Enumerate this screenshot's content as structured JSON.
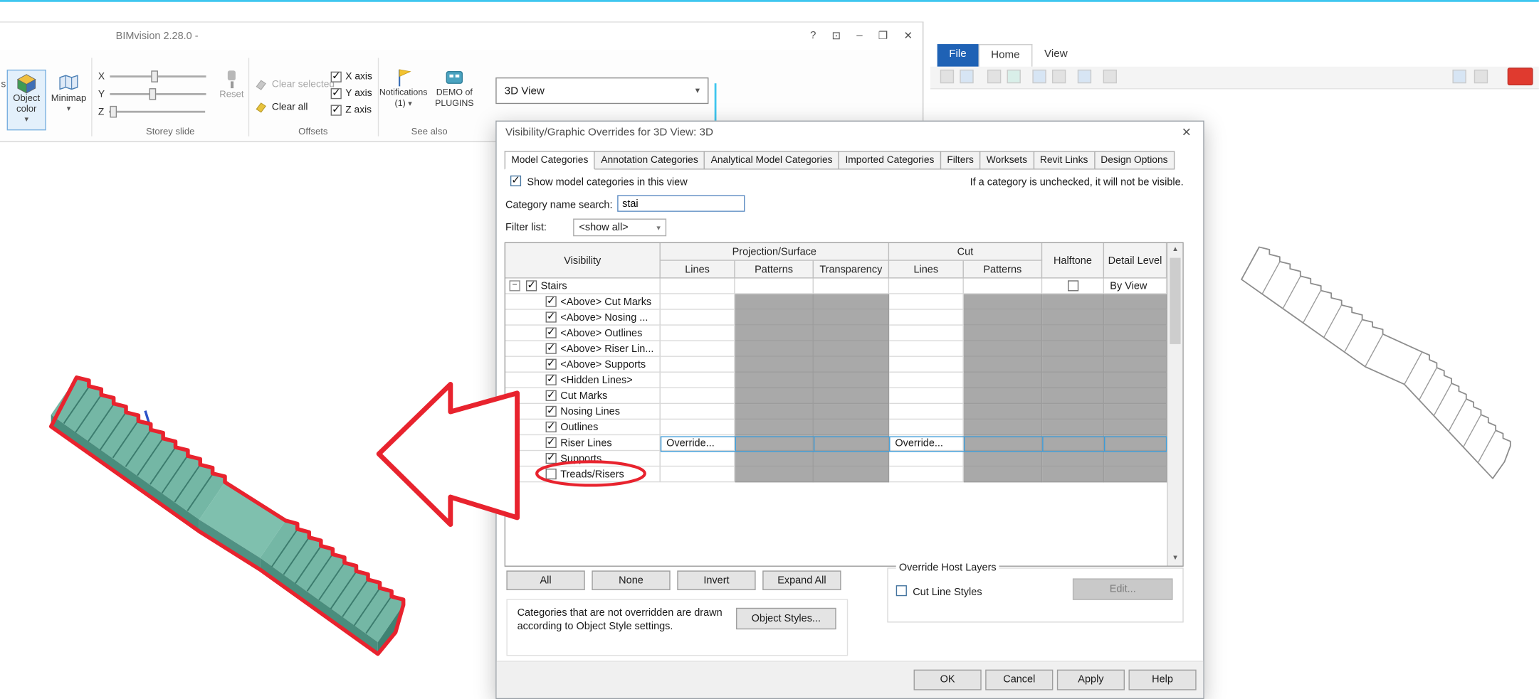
{
  "icons": {
    "caret_down": "▾",
    "up_arrow": "▲",
    "down_arrow": "▼",
    "help": "?",
    "pin": "⊡",
    "minimize": "–",
    "restore": "❐",
    "close": "✕",
    "dialog_close": "✕"
  },
  "bimvision": {
    "title": "BIMvision 2.28.0 -",
    "cut_label": "s",
    "object_color": "Object color",
    "minimap": "Minimap",
    "storey_slide": {
      "label": "Storey slide",
      "x": "X",
      "y": "Y",
      "z": "Z",
      "reset": "Reset"
    },
    "offsets": {
      "label": "Offsets",
      "clear_selected": "Clear selected",
      "clear_all": "Clear all",
      "x_axis": "X axis",
      "y_axis": "Y axis",
      "z_axis": "Z axis"
    },
    "see_also": {
      "label": "See also",
      "notifications_line1": "Notifications",
      "notifications_line2": "(1)",
      "demo_line1": "DEMO of",
      "demo_line2": "PLUGINS"
    }
  },
  "revit": {
    "file": "File",
    "home": "Home",
    "view": "View"
  },
  "view_selector": {
    "value": "3D View"
  },
  "dialog": {
    "title": "Visibility/Graphic Overrides for 3D View: 3D",
    "tabs": [
      "Model Categories",
      "Annotation Categories",
      "Analytical Model Categories",
      "Imported Categories",
      "Filters",
      "Worksets",
      "Revit Links",
      "Design Options"
    ],
    "show_label": "Show model categories in this view",
    "unchecked_note": "If a category is unchecked, it will not be visible.",
    "search_label": "Category name search:",
    "search_value": "stai",
    "filter_label": "Filter list:",
    "filter_value": "<show all>",
    "table": {
      "visibility": "Visibility",
      "projection": "Projection/Surface",
      "cut": "Cut",
      "halftone": "Halftone",
      "detail": "Detail Level",
      "lines": "Lines",
      "patterns": "Patterns",
      "transparency": "Transparency",
      "rows": [
        {
          "label": "Stairs",
          "detail": "By View"
        },
        {
          "label": "<Above> Cut Marks"
        },
        {
          "label": "<Above> Nosing ..."
        },
        {
          "label": "<Above> Outlines"
        },
        {
          "label": "<Above> Riser Lin..."
        },
        {
          "label": "<Above> Supports"
        },
        {
          "label": "<Hidden Lines>"
        },
        {
          "label": "Cut Marks"
        },
        {
          "label": "Nosing Lines"
        },
        {
          "label": "Outlines"
        },
        {
          "label": "Riser Lines",
          "proj_lines": "Override...",
          "cut_lines": "Override..."
        },
        {
          "label": "Supports"
        },
        {
          "label": "Treads/Risers"
        }
      ]
    },
    "all": "All",
    "none": "None",
    "invert": "Invert",
    "expand_all": "Expand All",
    "override_host": {
      "label": "Override Host Layers",
      "cut_line_styles": "Cut Line Styles",
      "edit": "Edit..."
    },
    "note": "Categories that are not overridden are drawn according to Object Style settings.",
    "object_styles": "Object Styles...",
    "ok": "OK",
    "cancel": "Cancel",
    "apply": "Apply",
    "help": "Help"
  }
}
